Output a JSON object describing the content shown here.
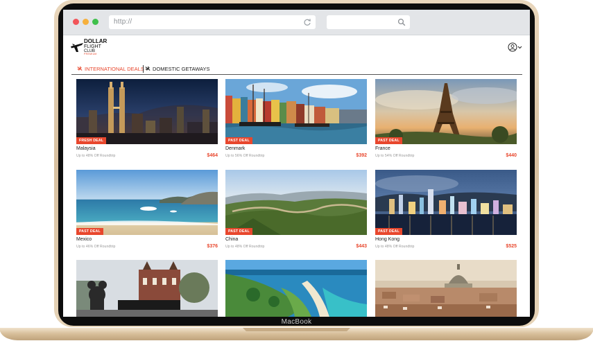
{
  "browser": {
    "url_text": "http://"
  },
  "logo": {
    "line1": "DOLLAR",
    "line2": "FLIGHT",
    "line3": "CLUB",
    "line4": "PREMIUM"
  },
  "tabs": [
    {
      "label": "INTERNATIONAL DEALS"
    },
    {
      "label": "DOMESTIC GETAWAYS"
    }
  ],
  "deals": [
    {
      "name": "Malaysia",
      "description": "Up to 48% Off Roundtrip",
      "price": "$464",
      "badge": "FRESH DEAL"
    },
    {
      "name": "Denmark",
      "description": "Up to 56% Off Roundtrip",
      "price": "$392",
      "badge": "PAST DEAL"
    },
    {
      "name": "France",
      "description": "Up to 54% Off Roundtrip",
      "price": "$440",
      "badge": "PAST DEAL"
    },
    {
      "name": "Mexico",
      "description": "Up to 46% Off Roundtrip",
      "price": "$376",
      "badge": "PAST DEAL"
    },
    {
      "name": "China",
      "description": "Up to 48% Off Roundtrip",
      "price": "$443",
      "badge": "PAST DEAL"
    },
    {
      "name": "Hong Kong",
      "description": "Up to 48% Off Roundtrip",
      "price": "$525",
      "badge": "PAST DEAL"
    }
  ],
  "device": {
    "brand": "MacBook"
  },
  "colors": {
    "accent": "#e8472d",
    "chrome": "#e3e5e8",
    "laptop_gold": "#d8c0a0"
  }
}
